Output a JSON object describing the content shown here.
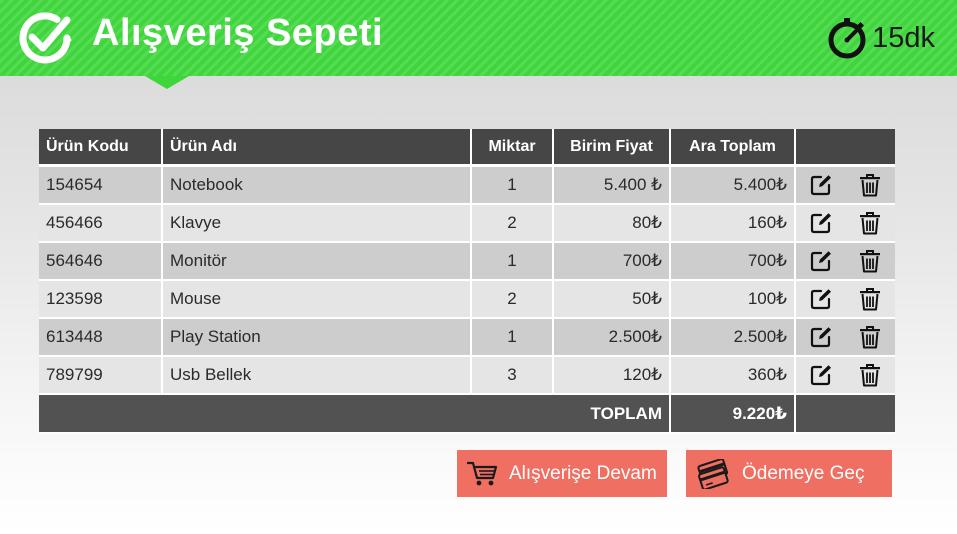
{
  "header": {
    "title": "Alışveriş Sepeti",
    "timer": "15dk",
    "logo_icon": "check-circle-icon",
    "timer_icon": "stopwatch-icon",
    "accent_color": "#3ed63c"
  },
  "table": {
    "columns": [
      "Ürün Kodu",
      "Ürün Adı",
      "Miktar",
      "Birim Fiyat",
      "Ara Toplam",
      ""
    ],
    "rows": [
      {
        "code": "154654",
        "name": "Notebook",
        "qty": "1",
        "unit_price": "5.400 ₺",
        "subtotal": "5.400₺"
      },
      {
        "code": "456466",
        "name": "Klavye",
        "qty": "2",
        "unit_price": "80₺",
        "subtotal": "160₺"
      },
      {
        "code": "564646",
        "name": "Monitör",
        "qty": "1",
        "unit_price": "700₺",
        "subtotal": "700₺"
      },
      {
        "code": "123598",
        "name": "Mouse",
        "qty": "2",
        "unit_price": "50₺",
        "subtotal": "100₺"
      },
      {
        "code": "613448",
        "name": "Play Station",
        "qty": "1",
        "unit_price": "2.500₺",
        "subtotal": "2.500₺"
      },
      {
        "code": "789799",
        "name": "Usb Bellek",
        "qty": "3",
        "unit_price": "120₺",
        "subtotal": "360₺"
      }
    ],
    "row_actions": [
      "edit-icon",
      "trash-icon"
    ],
    "total_label": "TOPLAM",
    "total_value": "9.220₺"
  },
  "buttons": {
    "continue_label": "Alışverişe Devam",
    "continue_icon": "cart-icon",
    "pay_label": "Ödemeye Geç",
    "pay_icon": "credit-card-icon",
    "color": "#ef6f62"
  }
}
